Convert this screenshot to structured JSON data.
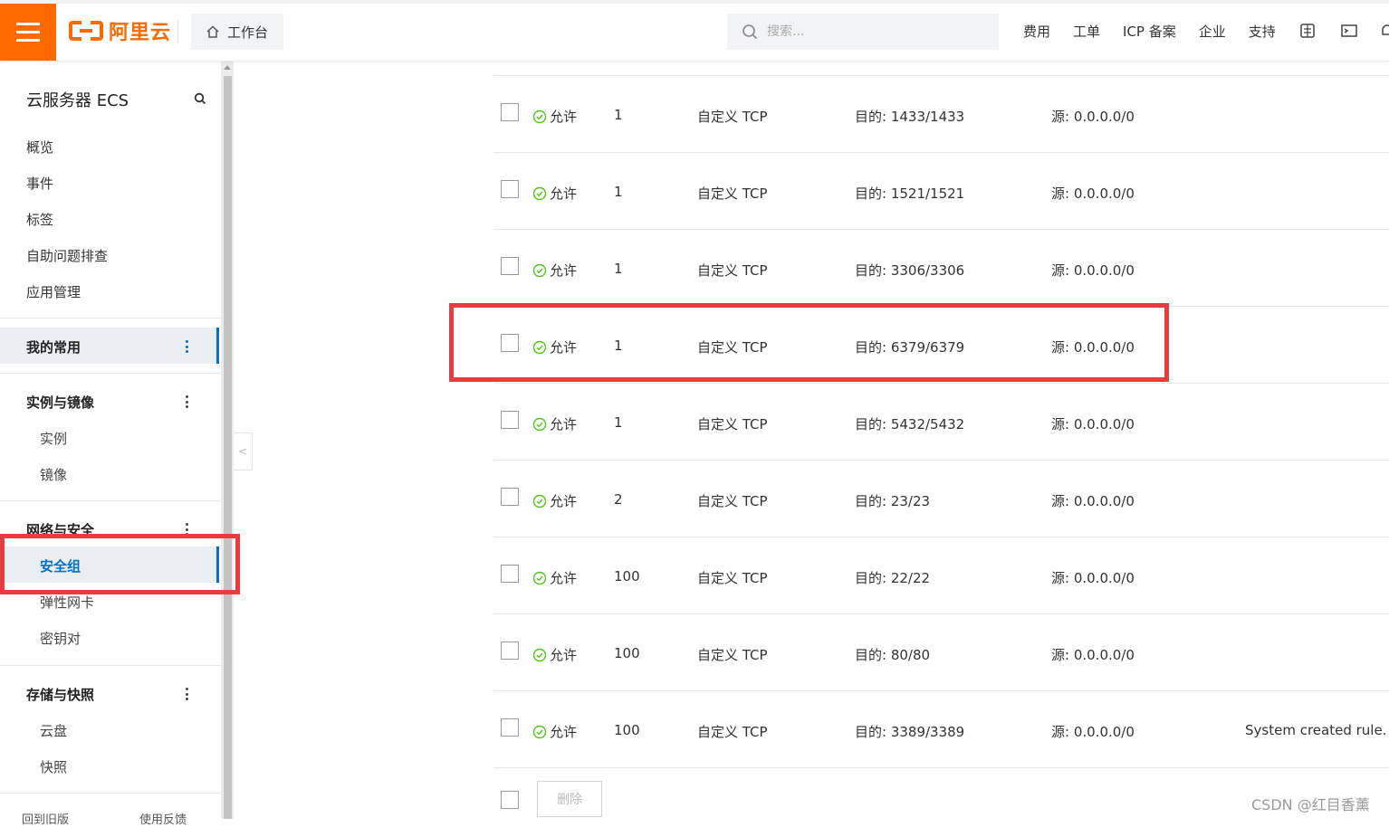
{
  "header": {
    "logo_text": "阿里云",
    "workbench_label": "工作台",
    "search_placeholder": "搜索...",
    "nav": [
      "费用",
      "工单",
      "ICP 备案",
      "企业",
      "支持"
    ]
  },
  "sidebar": {
    "title": "云服务器 ECS",
    "top_items": [
      "概览",
      "事件",
      "标签",
      "自助问题排查",
      "应用管理"
    ],
    "favorites_label": "我的常用",
    "groups": [
      {
        "label": "实例与镜像",
        "items": [
          "实例",
          "镜像"
        ]
      },
      {
        "label": "网络与安全",
        "items": [
          "安全组",
          "弹性网卡",
          "密钥对"
        ]
      },
      {
        "label": "存储与快照",
        "items": [
          "云盘",
          "快照"
        ]
      }
    ],
    "bottom_left": "回到旧版",
    "bottom_right": "使用反馈"
  },
  "rules": [
    {
      "action": "允许",
      "priority": "1",
      "protocol": "自定义 TCP",
      "port": "目的: 1433/1433",
      "source": "源: 0.0.0.0/0",
      "desc": ""
    },
    {
      "action": "允许",
      "priority": "1",
      "protocol": "自定义 TCP",
      "port": "目的: 1521/1521",
      "source": "源: 0.0.0.0/0",
      "desc": ""
    },
    {
      "action": "允许",
      "priority": "1",
      "protocol": "自定义 TCP",
      "port": "目的: 3306/3306",
      "source": "源: 0.0.0.0/0",
      "desc": ""
    },
    {
      "action": "允许",
      "priority": "1",
      "protocol": "自定义 TCP",
      "port": "目的: 6379/6379",
      "source": "源: 0.0.0.0/0",
      "desc": ""
    },
    {
      "action": "允许",
      "priority": "1",
      "protocol": "自定义 TCP",
      "port": "目的: 5432/5432",
      "source": "源: 0.0.0.0/0",
      "desc": ""
    },
    {
      "action": "允许",
      "priority": "2",
      "protocol": "自定义 TCP",
      "port": "目的: 23/23",
      "source": "源: 0.0.0.0/0",
      "desc": ""
    },
    {
      "action": "允许",
      "priority": "100",
      "protocol": "自定义 TCP",
      "port": "目的: 22/22",
      "source": "源: 0.0.0.0/0",
      "desc": ""
    },
    {
      "action": "允许",
      "priority": "100",
      "protocol": "自定义 TCP",
      "port": "目的: 80/80",
      "source": "源: 0.0.0.0/0",
      "desc": ""
    },
    {
      "action": "允许",
      "priority": "100",
      "protocol": "自定义 TCP",
      "port": "目的: 3389/3389",
      "source": "源: 0.0.0.0/0",
      "desc": "System created rule."
    }
  ],
  "delete_label": "删除",
  "watermark": "CSDN @红目香薰",
  "colors": {
    "brand": "#ff6a00",
    "highlight": "#ea3b3e",
    "allow_green": "#52c41a",
    "active_bar": "#0070cc"
  }
}
